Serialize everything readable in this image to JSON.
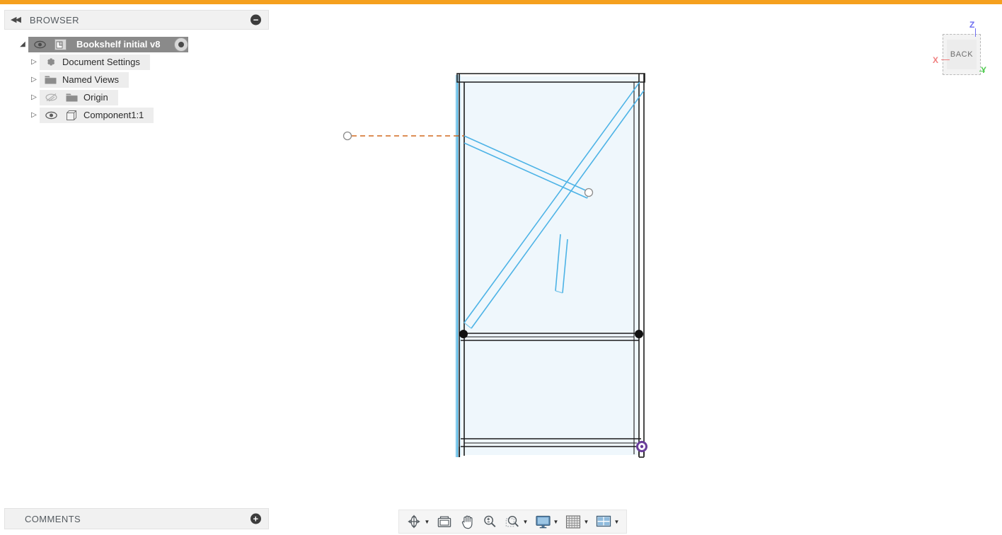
{
  "theme": {
    "accent_orange": "#f5a01e",
    "selection_gray": "#8a8a8a",
    "sketch_blue": "#4db3e6",
    "body_fill": "#eff7fc",
    "edge_black": "#1c1c1c",
    "dimension_orange": "#d2691e",
    "origin_purple": "#6a3d9a"
  },
  "browser": {
    "title": "BROWSER",
    "collapse_icon": "double-left-arrow-icon",
    "minimize_icon": "minus-circle-icon",
    "minimize_glyph": "−",
    "collapse_glyph": "◀◀",
    "tree": [
      {
        "label": "Bookshelf initial v8",
        "icon": "document-icon",
        "expander": "◢",
        "expanded": true,
        "selected": true,
        "has_eye": true,
        "eye_state": "visible",
        "has_target": true,
        "indent": 0
      },
      {
        "label": "Document Settings",
        "icon": "gear-icon",
        "expander": "▷",
        "expanded": false,
        "selected": false,
        "has_eye": false,
        "eye_state": "none",
        "has_target": false,
        "indent": 1
      },
      {
        "label": "Named Views",
        "icon": "folder-icon",
        "expander": "▷",
        "expanded": false,
        "selected": false,
        "has_eye": false,
        "eye_state": "none",
        "has_target": false,
        "indent": 1
      },
      {
        "label": "Origin",
        "icon": "folder-icon",
        "expander": "▷",
        "expanded": false,
        "selected": false,
        "has_eye": true,
        "eye_state": "hidden",
        "has_target": false,
        "indent": 1
      },
      {
        "label": "Component1:1",
        "icon": "component-icon",
        "expander": "▷",
        "expanded": false,
        "selected": false,
        "has_eye": true,
        "eye_state": "visible",
        "has_target": false,
        "indent": 1
      }
    ]
  },
  "comments": {
    "title": "COMMENTS",
    "add_icon": "plus-circle-icon",
    "add_glyph": "+"
  },
  "navbar": {
    "items": [
      {
        "name": "orbit-button",
        "icon": "orbit-icon",
        "has_caret": true
      },
      {
        "name": "look-at-button",
        "icon": "look-at-icon",
        "has_caret": false
      },
      {
        "name": "pan-button",
        "icon": "pan-hand-icon",
        "has_caret": false
      },
      {
        "name": "zoom-button",
        "icon": "zoom-magnifier-icon",
        "has_caret": false
      },
      {
        "name": "zoom-window-button",
        "icon": "zoom-window-icon",
        "has_caret": true
      },
      {
        "name": "display-settings-button",
        "icon": "monitor-icon",
        "has_caret": true
      },
      {
        "name": "grid-snaps-button",
        "icon": "grid-icon",
        "has_caret": true
      },
      {
        "name": "viewports-button",
        "icon": "viewports-icon",
        "has_caret": true
      }
    ],
    "caret_glyph": "▼"
  },
  "viewcube": {
    "face_label": "BACK",
    "axes": [
      {
        "name": "z-axis-label",
        "label": "Z",
        "color": "#6e6ef0"
      },
      {
        "name": "x-axis-label",
        "label": "X",
        "color": "#f08080"
      },
      {
        "name": "y-axis-label",
        "label": "Y",
        "color": "#4ec94e"
      }
    ]
  },
  "model": {
    "name": "bookshelf-back-view",
    "description": "Bookshelf frame viewed from BACK with sketch diagonal braces",
    "has_dimension_leader": true,
    "leader_color": "#d2691e",
    "origin_marker_color": "#6a3d9a",
    "selection_points": 2
  }
}
